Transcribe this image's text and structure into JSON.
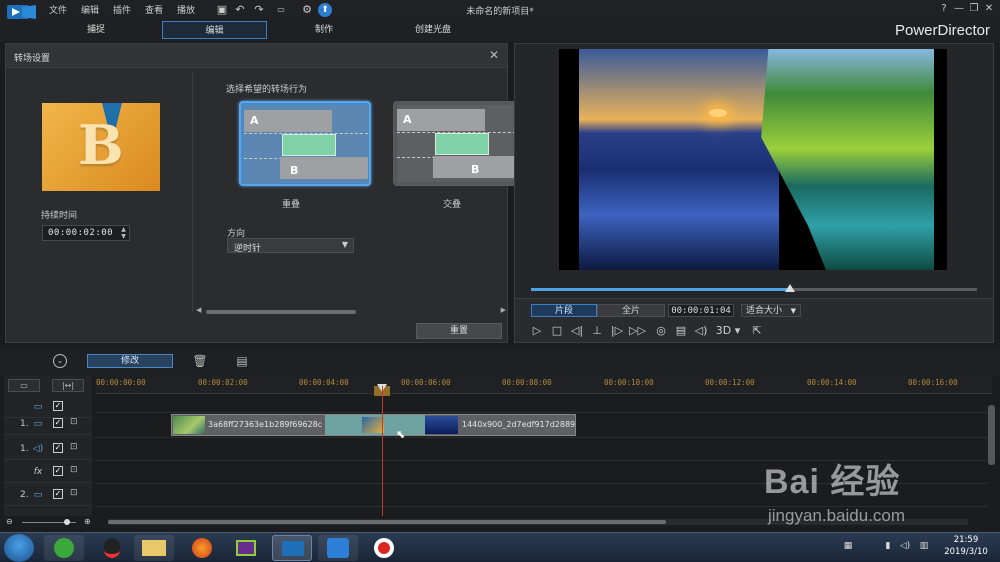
{
  "menu": [
    "文件",
    "编辑",
    "插件",
    "查看",
    "播放"
  ],
  "project_title": "未命名的新项目*",
  "window_buttons": [
    "?",
    "—",
    "❐",
    "✕"
  ],
  "mode_tabs": [
    {
      "label": "捕捉",
      "active": false
    },
    {
      "label": "编辑",
      "active": true
    },
    {
      "label": "制作",
      "active": false
    },
    {
      "label": "创建光盘",
      "active": false
    }
  ],
  "brand": "PowerDirector",
  "transition_panel": {
    "title": "转场设置",
    "duration_label": "持续时间",
    "duration_value": "00:00:02:00",
    "choose_label": "选择希望的转场行为",
    "options": [
      {
        "label": "重叠",
        "selected": true,
        "a": "A",
        "b": "B"
      },
      {
        "label": "交叠",
        "selected": false,
        "a": "A",
        "b": "B"
      }
    ],
    "direction_label": "方向",
    "direction_value": "逆时针",
    "reset_label": "重置"
  },
  "preview": {
    "clip_label": "片段",
    "full_label": "全片",
    "timecode": "00:00:01:04",
    "fit_label": "适合大小",
    "playhead_progress": 0.58,
    "controls": [
      "play-icon",
      "stop-icon",
      "prev-frame-icon",
      "split-icon",
      "next-frame-icon",
      "fast-forward-icon",
      "snapshot-icon",
      "subtitle-icon",
      "volume-icon",
      "3d-icon",
      "undock-icon"
    ],
    "three_d_label": "3D"
  },
  "toolbar": {
    "modify_label": "修改"
  },
  "ruler_ticks": [
    "00:00:00:00",
    "00:00:02:00",
    "00:00:04:00",
    "00:00:06:00",
    "00:00:08:00",
    "00:00:10:00",
    "00:00:12:00",
    "00:00:14:00",
    "00:00:16:00"
  ],
  "tracks": [
    {
      "num": "",
      "type": "video"
    },
    {
      "num": "1.",
      "type": "video"
    },
    {
      "num": "1.",
      "type": "audio"
    },
    {
      "num": "",
      "type": "fx",
      "icon_text": "fx"
    },
    {
      "num": "2.",
      "type": "video"
    }
  ],
  "clips": {
    "a_name": "3a68ff27363e1b289f69628c",
    "b_name": "1440x900_2d7edf917d2889"
  },
  "taskbar": {
    "time": "21:59",
    "date": "2019/3/10"
  },
  "watermark": {
    "main": "Bai 经验",
    "url": "jingyan.baidu.com"
  },
  "colors": {
    "accent": "#4ea3e6",
    "playhead": "#c0392b",
    "ruler_text": "#b08a3a",
    "transition_green": "#7fd1a8"
  }
}
